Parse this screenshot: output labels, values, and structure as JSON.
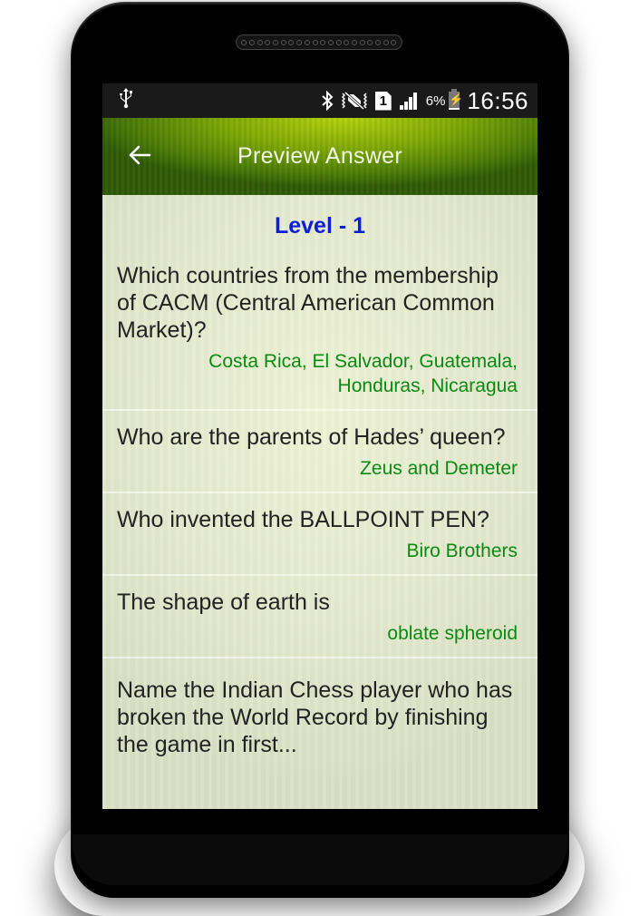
{
  "status_bar": {
    "usb_icon": "usb-icon",
    "icons": [
      "bluetooth-icon",
      "vibrate-silent-icon",
      "sim-1-icon",
      "signal-icon"
    ],
    "sim_label": "1",
    "battery_percent": "6%",
    "battery_icon": "battery-charging-icon",
    "time": "16:56"
  },
  "app_bar": {
    "back_icon": "arrow-left-icon",
    "title": "Preview Answer"
  },
  "level_label": "Level - 1",
  "items": [
    {
      "question": "Which countries from the membership of CACM (Central American Common Market)?",
      "answer": "Costa Rica, El Salvador, Guatemala, Honduras, Nicaragua"
    },
    {
      "question": "Who are the parents of Hades’ queen?",
      "answer": "Zeus and Demeter"
    },
    {
      "question": "Who invented the BALLPOINT PEN?",
      "answer": "Biro Brothers"
    },
    {
      "question": "The shape of earth is",
      "answer": "oblate spheroid"
    },
    {
      "question": "Name the Indian Chess player who has broken the World Record by finishing the game in first..."
    }
  ],
  "colors": {
    "app_bar": "#7fa805",
    "level": "#0e1ed6",
    "answer": "#0a8a12",
    "question": "#222222"
  }
}
